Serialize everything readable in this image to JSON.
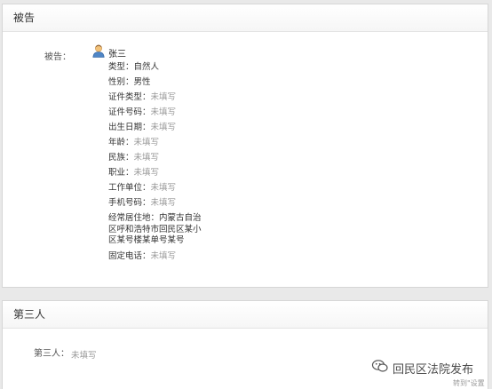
{
  "defendant_panel": {
    "title": "被告",
    "field_label": "被告：",
    "name": "张三",
    "rows": [
      {
        "label": "类型：",
        "value": "自然人",
        "empty": false
      },
      {
        "label": "性别：",
        "value": "男性",
        "empty": false
      },
      {
        "label": "证件类型：",
        "value": "未填写",
        "empty": true
      },
      {
        "label": "证件号码：",
        "value": "未填写",
        "empty": true
      },
      {
        "label": "出生日期：",
        "value": "未填写",
        "empty": true
      },
      {
        "label": "年龄：",
        "value": "未填写",
        "empty": true
      },
      {
        "label": "民族：",
        "value": "未填写",
        "empty": true
      },
      {
        "label": "职业：",
        "value": "未填写",
        "empty": true
      },
      {
        "label": "工作单位：",
        "value": "未填写",
        "empty": true
      },
      {
        "label": "手机号码：",
        "value": "未填写",
        "empty": true
      }
    ],
    "address": {
      "label": "经常居住地：",
      "lines": [
        "内蒙古自治",
        "区呼和浩特市回民区某小",
        "区某号楼某单号某号"
      ]
    },
    "landline": {
      "label": "固定电话：",
      "value": "未填写"
    }
  },
  "third_party_panel": {
    "title": "第三人",
    "field_label": "第三人：",
    "value": "未填写"
  },
  "watermark": {
    "text": "回民区法院发布",
    "small_text": "转到\"设置"
  },
  "colors": {
    "empty_value": "#999999",
    "panel_border": "#d6d6d6",
    "page_bg": "#e9e9e9"
  }
}
